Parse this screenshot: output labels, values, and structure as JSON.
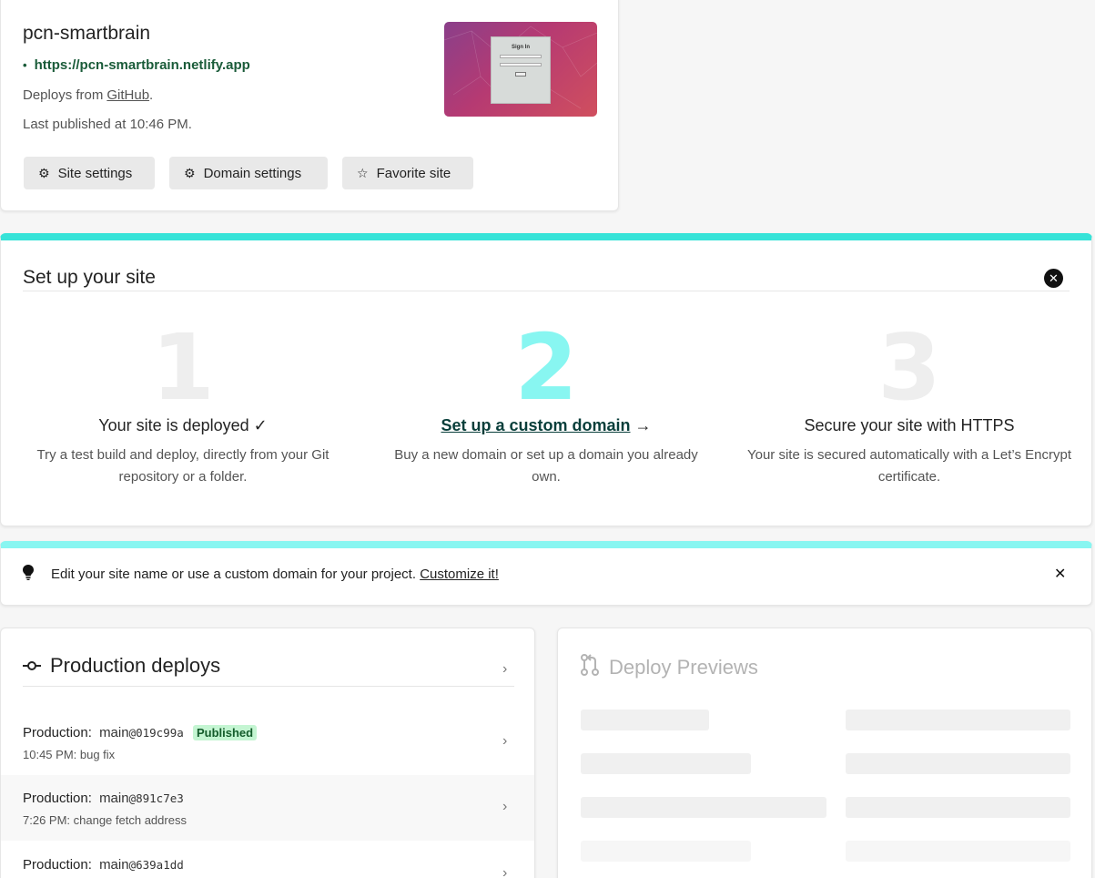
{
  "site": {
    "name": "pcn-smartbrain",
    "url": "https://pcn-smartbrain.netlify.app",
    "url_dot": "•",
    "deploys_from_prefix": "Deploys from",
    "deploys_from_source": "GitHub",
    "deploys_from_suffix": ".",
    "last_published": "Last published at 10:46 PM.",
    "buttons": {
      "site_settings": "Site settings",
      "domain_settings": "Domain settings",
      "favorite_site": "Favorite site"
    },
    "thumbnail": {
      "title": "Sign In"
    }
  },
  "setup": {
    "title": "Set up your site",
    "steps": [
      {
        "number": "1",
        "heading": "Your site is deployed ✓",
        "description": "Try a test build and deploy, directly from your Git repository or a folder."
      },
      {
        "number": "2",
        "heading_link": "Set up a custom domain",
        "heading_arrow": " →",
        "description": "Buy a new domain or set up a domain you already own."
      },
      {
        "number": "3",
        "heading": "Secure your site with HTTPS",
        "description": "Your site is secured automatically with a Let’s Encrypt certificate."
      }
    ]
  },
  "tip": {
    "text": "Edit your site name or use a custom domain for your project.",
    "link": "Customize it!"
  },
  "production": {
    "title": "Production deploys",
    "deploys": [
      {
        "context": "Production:",
        "branch": "main",
        "commit": "@019c99a",
        "badge": "Published",
        "message": "10:45 PM: bug fix"
      },
      {
        "context": "Production:",
        "branch": "main",
        "commit": "@891c7e3",
        "message": "7:26 PM: change fetch address"
      },
      {
        "context": "Production:",
        "branch": "main",
        "commit": "@639a1dd",
        "message": ""
      }
    ]
  },
  "previews": {
    "title": "Deploy Previews"
  },
  "colors": {
    "setup_accent": "#36e3d8",
    "tip_accent": "#88f6f1",
    "published_badge": "#c4f5d2",
    "link_dark": "#1a5b39"
  },
  "icons": {
    "gear": "⚙",
    "star": "☆",
    "close_circle": "✕",
    "lightbulb": "💡",
    "close": "✕",
    "chevron": "›",
    "commit": "-o-",
    "pull_request": "⇄"
  }
}
